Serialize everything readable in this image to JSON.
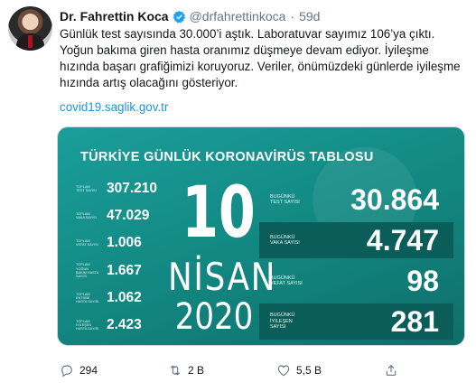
{
  "tweet": {
    "author_name": "Dr. Fahrettin Koca",
    "handle": "@drfahrettinkoca",
    "separator": "·",
    "time": "59d",
    "text": "Günlük test sayısında 30.000’i aştık. Laboratuvar sayımız 106’ya çıktı. Yoğun bakıma giren hasta oranımız düşmeye devam ediyor. İyileşme hızında başarı grafiğimizi koruyoruz. Veriler, önümüzdeki günlerde iyileşme hızında artış olacağını gösteriyor.",
    "link": "covid19.saglik.gov.tr"
  },
  "card": {
    "title": "TÜRKİYE GÜNLÜK KORONAVİRÜS TABLOSU",
    "day": "10",
    "month": "NİSAN",
    "year": "2020",
    "left_stats": [
      {
        "label": "TOPLAM TEST SAYISI",
        "value": "307.210"
      },
      {
        "label": "TOPLAM VAKA SAYISI",
        "value": "47.029"
      },
      {
        "label": "TOPLAM VEFAT SAYISI",
        "value": "1.006"
      },
      {
        "label": "TOPLAM YOĞUN BAKIM HASTA SAYISI",
        "value": "1.667"
      },
      {
        "label": "TOPLAM ENTÜBE HASTA SAYISI",
        "value": "1.062"
      },
      {
        "label": "TOPLAM İYİLEŞEN HASTA SAYISI",
        "value": "2.423"
      }
    ],
    "right_stats": [
      {
        "label": "BUGÜNKÜ TEST SAYISI",
        "value": "30.864"
      },
      {
        "label": "BUGÜNKÜ VAKA SAYISI",
        "value": "4.747"
      },
      {
        "label": "BUGÜNKÜ VEFAT SAYISI",
        "value": "98"
      },
      {
        "label": "BUGÜNKÜ İYİLEŞEN SAYISI",
        "value": "281"
      }
    ]
  },
  "actions": {
    "reply_count": "294",
    "retweet_count": "2 B",
    "like_count": "5,5 B"
  },
  "colors": {
    "link": "#1b95e0",
    "verified": "#1da1f2",
    "card_teal": "#128680",
    "muted": "#657786"
  },
  "icons": [
    "verified-badge-icon",
    "reply-icon",
    "retweet-icon",
    "like-icon",
    "share-icon"
  ]
}
